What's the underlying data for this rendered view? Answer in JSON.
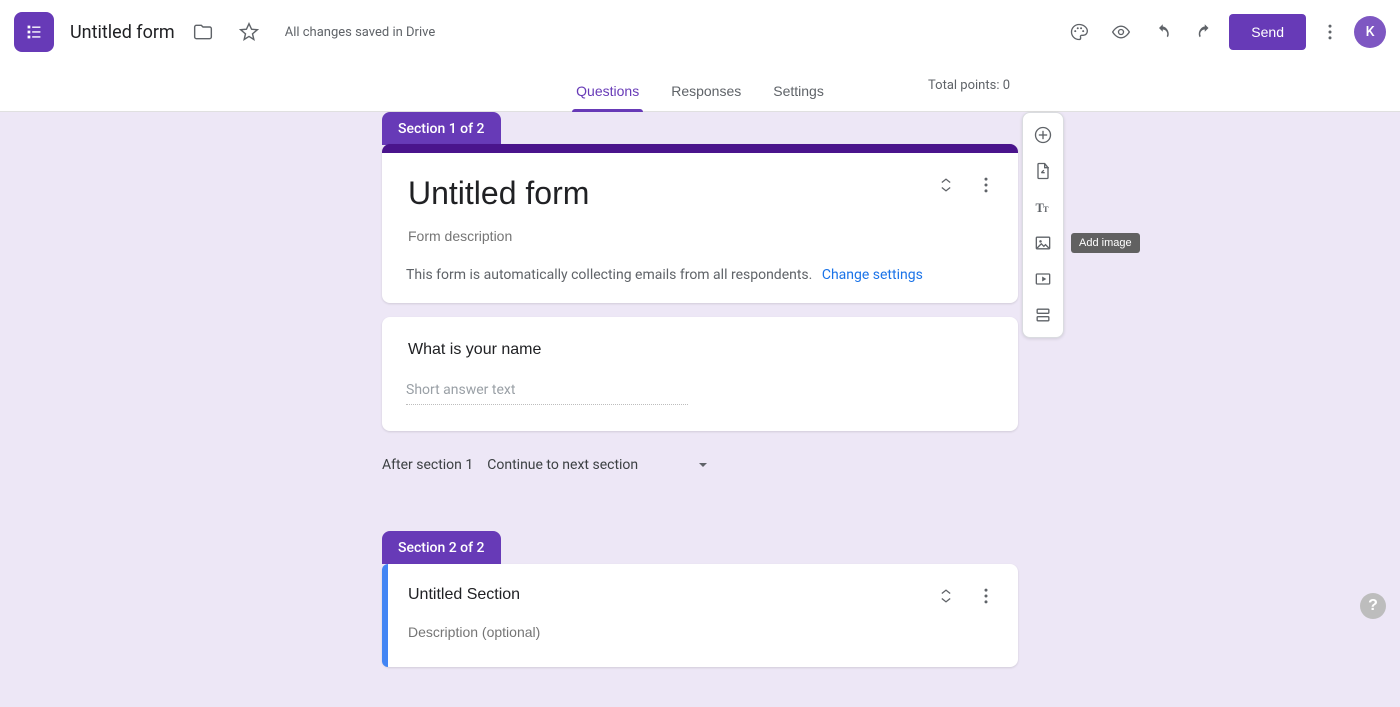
{
  "colors": {
    "accent": "#673ab7",
    "body_bg": "#ede7f6",
    "link": "#1a73e8"
  },
  "header": {
    "doc_title": "Untitled form",
    "save_status": "All changes saved in Drive",
    "send_label": "Send",
    "avatar_initial": "K"
  },
  "tabs": {
    "questions": "Questions",
    "responses": "Responses",
    "settings": "Settings",
    "total_points": "Total points: 0"
  },
  "section1": {
    "tab_label": "Section 1 of 2",
    "form_title": "Untitled form",
    "form_description_placeholder": "Form description",
    "info_text": "This form is automatically collecting emails from all respondents.",
    "info_link": "Change settings"
  },
  "question1": {
    "title": "What is your name",
    "answer_placeholder": "Short answer text"
  },
  "after_section": {
    "label": "After section 1",
    "value": "Continue to next section"
  },
  "section2": {
    "tab_label": "Section 2 of 2",
    "title": "Untitled Section",
    "description_placeholder": "Description (optional)"
  },
  "floating_toolbar": {
    "add_image_tooltip": "Add image"
  }
}
